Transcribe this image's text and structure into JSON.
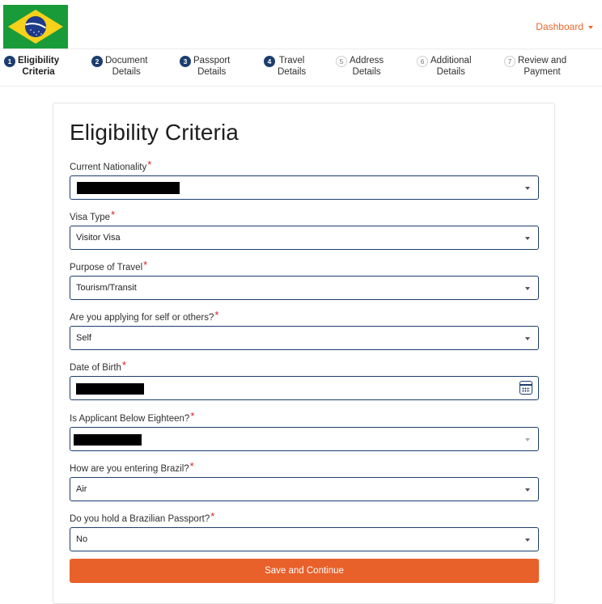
{
  "header": {
    "dashboard_label": "Dashboard",
    "colors": {
      "accent": "#e8682a",
      "primary": "#1c3d6e",
      "flag_green": "#1a9b3a",
      "flag_yellow": "#f7d11a",
      "flag_blue": "#1e3a8a"
    }
  },
  "stepper": {
    "steps": [
      {
        "number": "1",
        "label_line1": "Eligibility",
        "label_line2": "Criteria",
        "state": "active"
      },
      {
        "number": "2",
        "label_line1": "Document",
        "label_line2": "Details",
        "state": "enabled"
      },
      {
        "number": "3",
        "label_line1": "Passport",
        "label_line2": "Details",
        "state": "enabled"
      },
      {
        "number": "4",
        "label_line1": "Travel",
        "label_line2": "Details",
        "state": "enabled"
      },
      {
        "number": "5",
        "label_line1": "Address",
        "label_line2": "Details",
        "state": "pending"
      },
      {
        "number": "6",
        "label_line1": "Additional",
        "label_line2": "Details",
        "state": "pending"
      },
      {
        "number": "7",
        "label_line1": "Review and",
        "label_line2": "Payment",
        "state": "pending"
      }
    ]
  },
  "form": {
    "title": "Eligibility Criteria",
    "required_marker": "*",
    "fields": {
      "nationality": {
        "label": "Current Nationality",
        "value": "",
        "redacted": true
      },
      "visa_type": {
        "label": "Visa Type",
        "value": "Visitor Visa"
      },
      "purpose": {
        "label": "Purpose of Travel",
        "value": "Tourism/Transit"
      },
      "applying_for": {
        "label": "Are you applying for self or others?",
        "value": "Self"
      },
      "dob": {
        "label": "Date of Birth",
        "value": "",
        "redacted": true
      },
      "below_eighteen": {
        "label": "Is Applicant Below Eighteen?",
        "value": "",
        "redacted": true
      },
      "entry_mode": {
        "label": "How are you entering Brazil?",
        "value": "Air"
      },
      "brazilian_passport": {
        "label": "Do you hold a Brazilian Passport?",
        "value": "No"
      }
    },
    "submit_label": "Save and Continue"
  }
}
